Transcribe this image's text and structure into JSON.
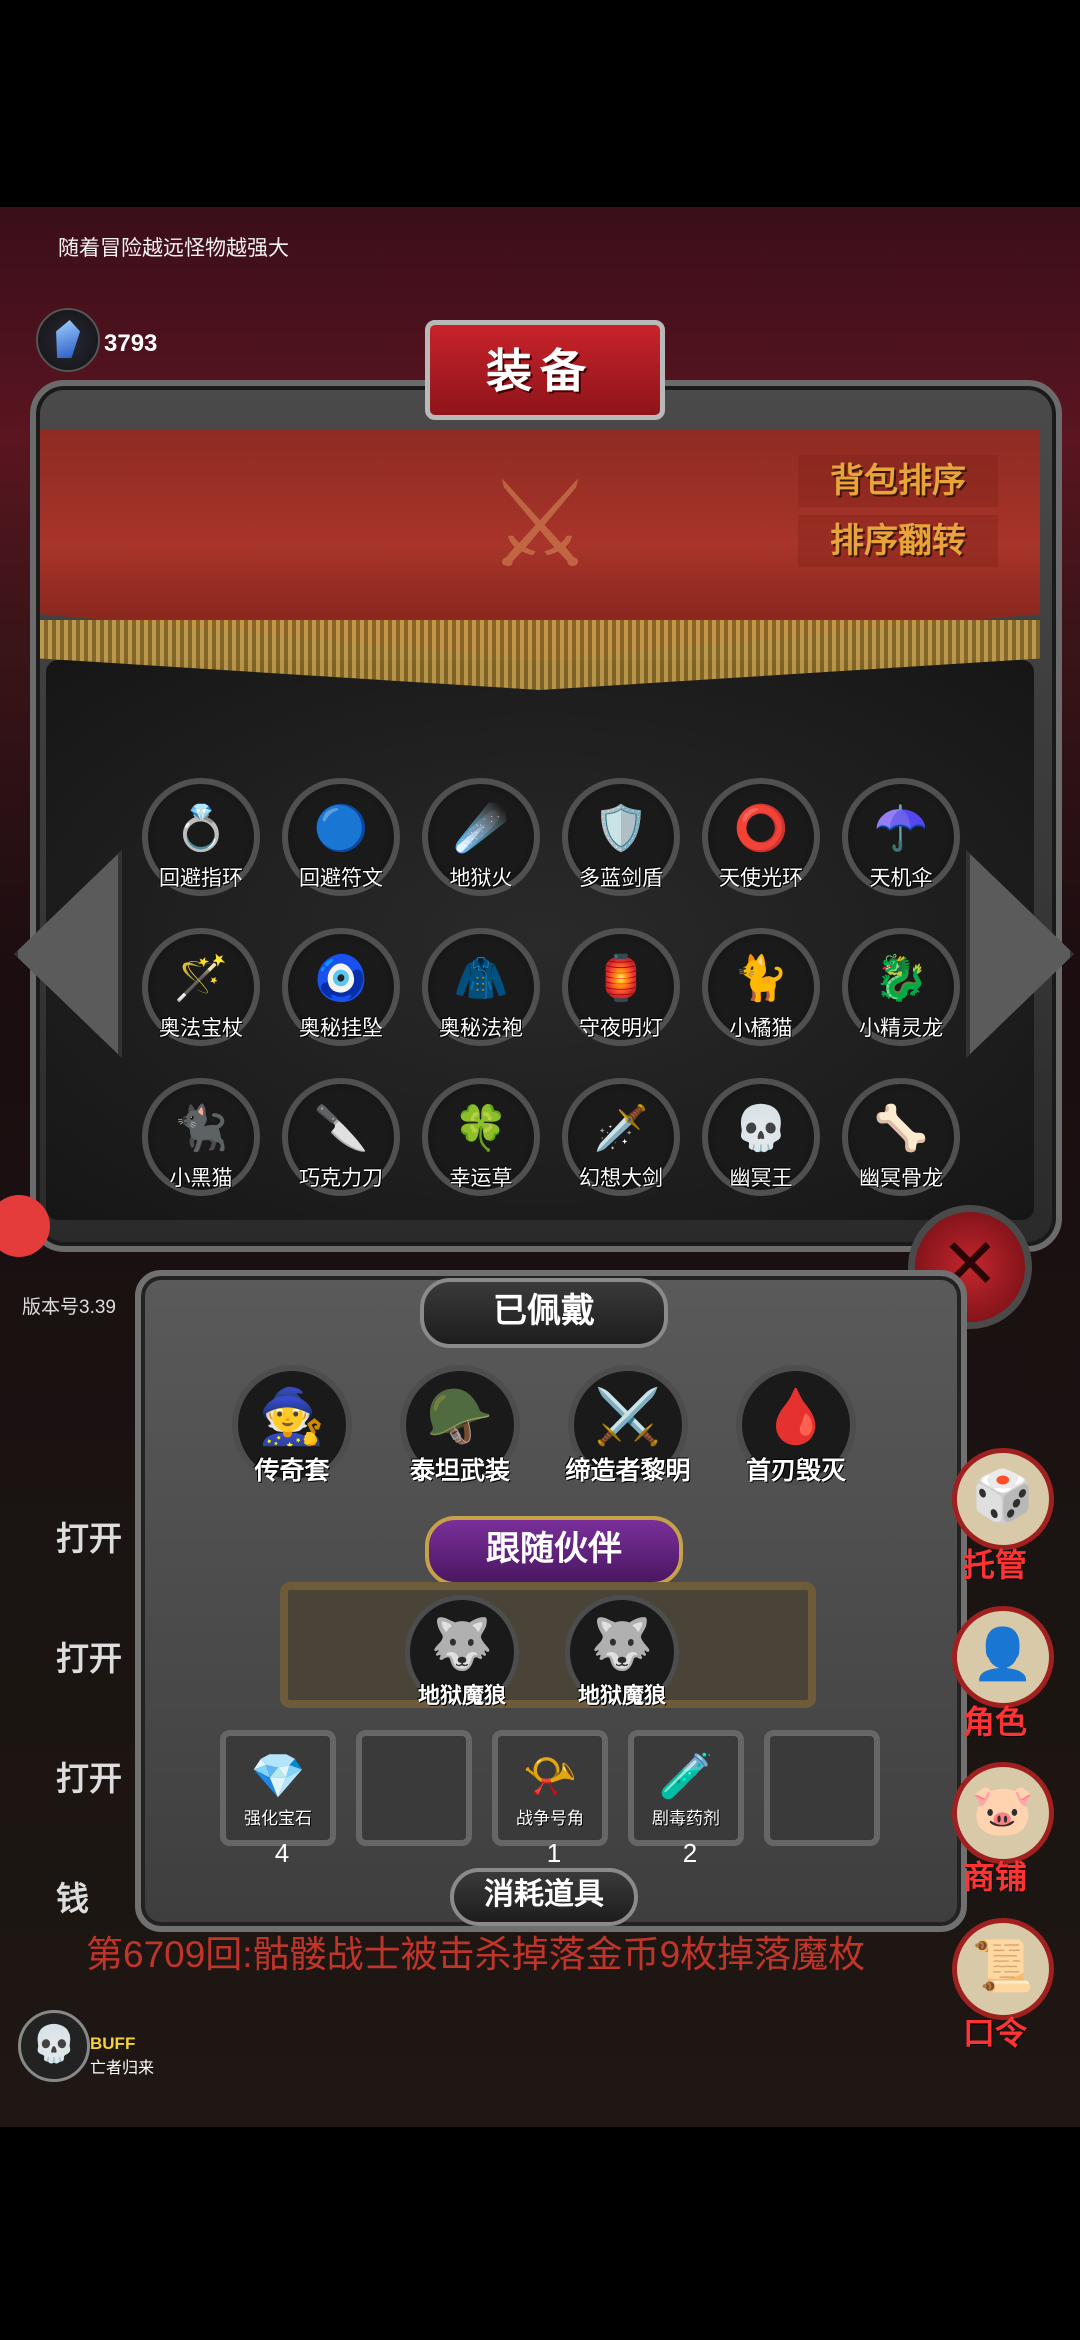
{
  "hint_text": "随着冒险越远怪物越强大",
  "gem_count": "3793",
  "gem_label": "宝石",
  "panel_title": "装备",
  "sort_buttons": {
    "sort": "背包排序",
    "reverse": "排序翻转"
  },
  "inventory": [
    {
      "name": "回避指环",
      "icon": "💍"
    },
    {
      "name": "回避符文",
      "icon": "🔵"
    },
    {
      "name": "地狱火",
      "icon": "☄️"
    },
    {
      "name": "多蓝剑盾",
      "icon": "🛡️"
    },
    {
      "name": "天使光环",
      "icon": "⭕"
    },
    {
      "name": "天机伞",
      "icon": "☂️"
    },
    {
      "name": "奥法宝杖",
      "icon": "🪄"
    },
    {
      "name": "奥秘挂坠",
      "icon": "🧿"
    },
    {
      "name": "奥秘法袍",
      "icon": "🧥"
    },
    {
      "name": "守夜明灯",
      "icon": "🏮"
    },
    {
      "name": "小橘猫",
      "icon": "🐈"
    },
    {
      "name": "小精灵龙",
      "icon": "🐉"
    },
    {
      "name": "小黑猫",
      "icon": "🐈‍⬛"
    },
    {
      "name": "巧克力刀",
      "icon": "🔪"
    },
    {
      "name": "幸运草",
      "icon": "🍀"
    },
    {
      "name": "幻想大剑",
      "icon": "🗡️"
    },
    {
      "name": "幽冥王",
      "icon": "💀"
    },
    {
      "name": "幽冥骨龙",
      "icon": "🦴"
    }
  ],
  "version": "版本号3.39",
  "equipped": {
    "title": "已佩戴",
    "items": [
      {
        "name": "传奇套",
        "icon": "🧙"
      },
      {
        "name": "泰坦武装",
        "icon": "🪖"
      },
      {
        "name": "缔造者黎明",
        "icon": "⚔️"
      },
      {
        "name": "首刃毁灭",
        "icon": "🩸"
      }
    ]
  },
  "companions": {
    "title": "跟随伙伴",
    "items": [
      {
        "name": "地狱魔狼",
        "icon": "🐺"
      },
      {
        "name": "地狱魔狼",
        "icon": "🐺"
      }
    ]
  },
  "consumables": {
    "title": "消耗道具",
    "slots": [
      {
        "name": "强化宝石",
        "icon": "💎",
        "count": "4"
      },
      {
        "name": "",
        "icon": "",
        "count": ""
      },
      {
        "name": "战争号角",
        "icon": "📯",
        "count": "1"
      },
      {
        "name": "剧毒药剂",
        "icon": "🧪",
        "count": "2"
      },
      {
        "name": "",
        "icon": "",
        "count": ""
      }
    ]
  },
  "side_buttons": [
    {
      "label": "托管",
      "icon": "🎲"
    },
    {
      "label": "角色",
      "icon": "👤"
    },
    {
      "label": "商铺",
      "icon": "🐷"
    },
    {
      "label": "口令",
      "icon": "📜"
    }
  ],
  "background_log": [
    "打开",
    "打开",
    "打开",
    "钱"
  ],
  "red_log": "第6709回:骷髅战士被击杀掉落金币9枚掉落魔枚",
  "buff": {
    "title": "BUFF",
    "subtitle": "亡者归来",
    "icon": "💀"
  }
}
